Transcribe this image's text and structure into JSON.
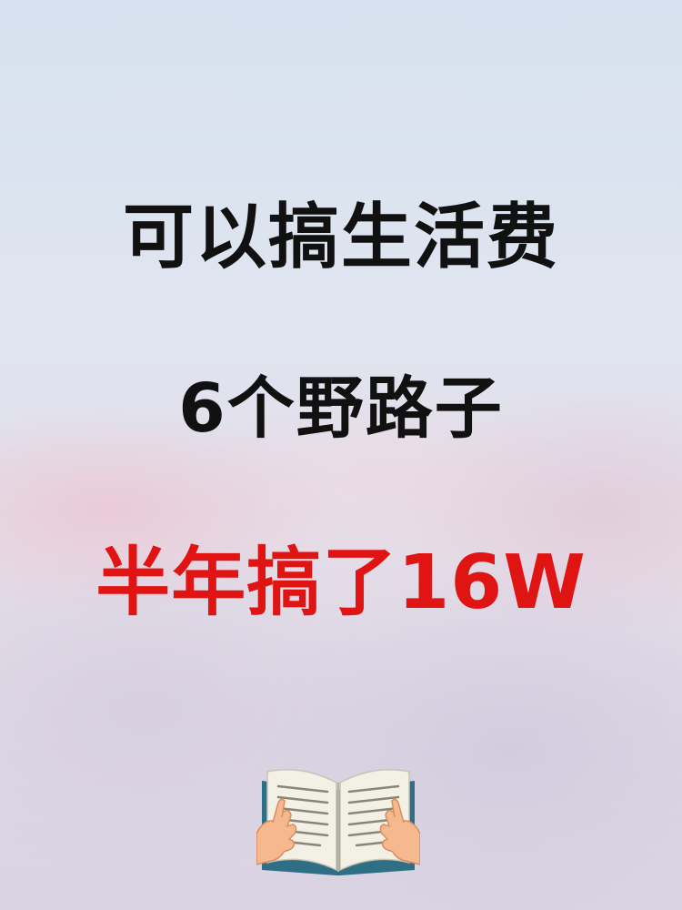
{
  "headline": {
    "line1": "可以搞生活费",
    "line2": "6个野路子",
    "line3": "半年搞了16W"
  },
  "colors": {
    "line1": "#111111",
    "line2": "#111111",
    "line3": "#e11414"
  },
  "icon": "open-book-hands-icon"
}
